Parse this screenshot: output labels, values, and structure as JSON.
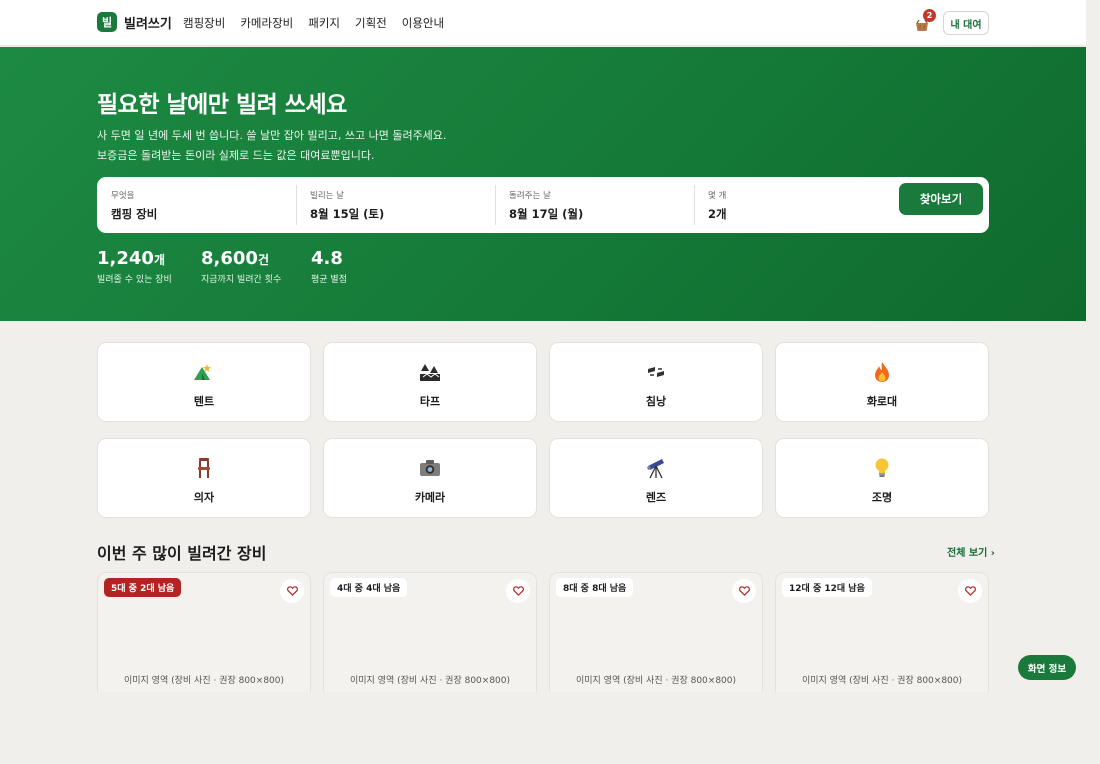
{
  "header": {
    "logo_mark": "빌",
    "logo_text": "빌려쓰기",
    "nav": [
      "캠핑장비",
      "카메라장비",
      "패키지",
      "기획전",
      "이용안내"
    ],
    "cart_count": "2",
    "my_rental": "내 대여"
  },
  "hero": {
    "title": "필요한 날에만 빌려 쓰세요",
    "sub1": "사 두면 일 년에 두세 번 씁니다. 쓸 날만 잡아 빌리고, 쓰고 나면 돌려주세요.",
    "sub2": "보증금은 돌려받는 돈이라 실제로 드는 값은 대여료뿐입니다."
  },
  "search": {
    "what_label": "무엇을",
    "what_value": "캠핑 장비",
    "start_label": "빌리는 날",
    "start_value": "8월 15일 (토)",
    "end_label": "돌려주는 날",
    "end_value": "8월 17일 (월)",
    "qty_label": "몇 개",
    "qty_value": "2개",
    "button": "찾아보기"
  },
  "stats": [
    {
      "num": "1,240",
      "unit": "개",
      "cap": "빌려줄 수 있는 장비"
    },
    {
      "num": "8,600",
      "unit": "건",
      "cap": "지금까지 빌려간 횟수"
    },
    {
      "num": "4.8",
      "unit": "",
      "cap": "평균 별점"
    }
  ],
  "categories": [
    {
      "name": "텐트",
      "icon": "tent-icon"
    },
    {
      "name": "타프",
      "icon": "tarp-icon"
    },
    {
      "name": "침낭",
      "icon": "sleeping-bag-icon"
    },
    {
      "name": "화로대",
      "icon": "fire-icon"
    },
    {
      "name": "의자",
      "icon": "chair-icon"
    },
    {
      "name": "카메라",
      "icon": "camera-icon"
    },
    {
      "name": "렌즈",
      "icon": "telescope-icon"
    },
    {
      "name": "조명",
      "icon": "light-bulb-icon"
    }
  ],
  "section": {
    "title": "이번 주 많이 빌려간 장비",
    "link": "전체 보기 ›"
  },
  "products": [
    {
      "badge": "5대 중 2대 남음",
      "placeholder": "이미지 영역 (장비 사진 · 권장 800×800)"
    },
    {
      "badge": "4대 중 4대 남음",
      "placeholder": "이미지 영역 (장비 사진 · 권장 800×800)"
    },
    {
      "badge": "8대 중 8대 남음",
      "placeholder": "이미지 영역 (장비 사진 · 권장 800×800)"
    },
    {
      "badge": "12대 중 12대 남음",
      "placeholder": "이미지 영역 (장비 사진 · 권장 800×800)"
    }
  ],
  "fab": "화면 정보",
  "colors": {
    "brand": "#1a7a3c",
    "badge_hot": "#b42323",
    "background": "#f1efeb"
  }
}
